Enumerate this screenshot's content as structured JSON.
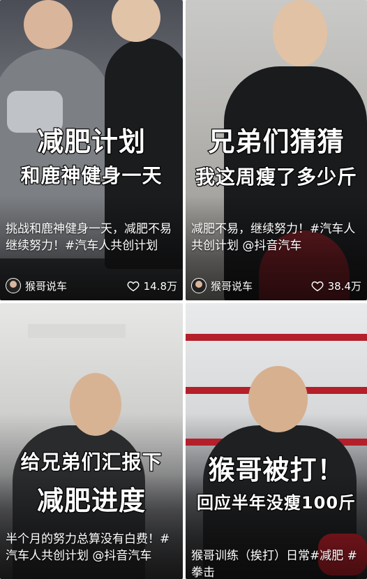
{
  "cards": [
    {
      "headline1": "减肥计划",
      "headline2": "和鹿神健身一天",
      "caption": "挑战和鹿神健身一天，减肥不易继续努力！#汽车人共创计划",
      "author": "猴哥说车",
      "likes": "14.8万"
    },
    {
      "headline1": "兄弟们猜猜",
      "headline2": "我这周瘦了多少斤",
      "caption": "减肥不易，继续努力！#汽车人共创计划 @抖音汽车",
      "author": "猴哥说车",
      "likes": "38.4万"
    },
    {
      "headline1": "给兄弟们汇报下",
      "headline2": "减肥进度",
      "caption": "半个月的努力总算没有白费！#汽车人共创计划 @抖音汽车"
    },
    {
      "headline1": "猴哥被打！",
      "headline2": "回应半年没瘦100斤",
      "caption": "猴哥训练（挨打）日常#减肥 #拳击"
    }
  ],
  "icons": {
    "like": "heart-icon",
    "avatar": "avatar-icon"
  },
  "colors": {
    "text": "#ffffff",
    "stroke": "#000000"
  }
}
